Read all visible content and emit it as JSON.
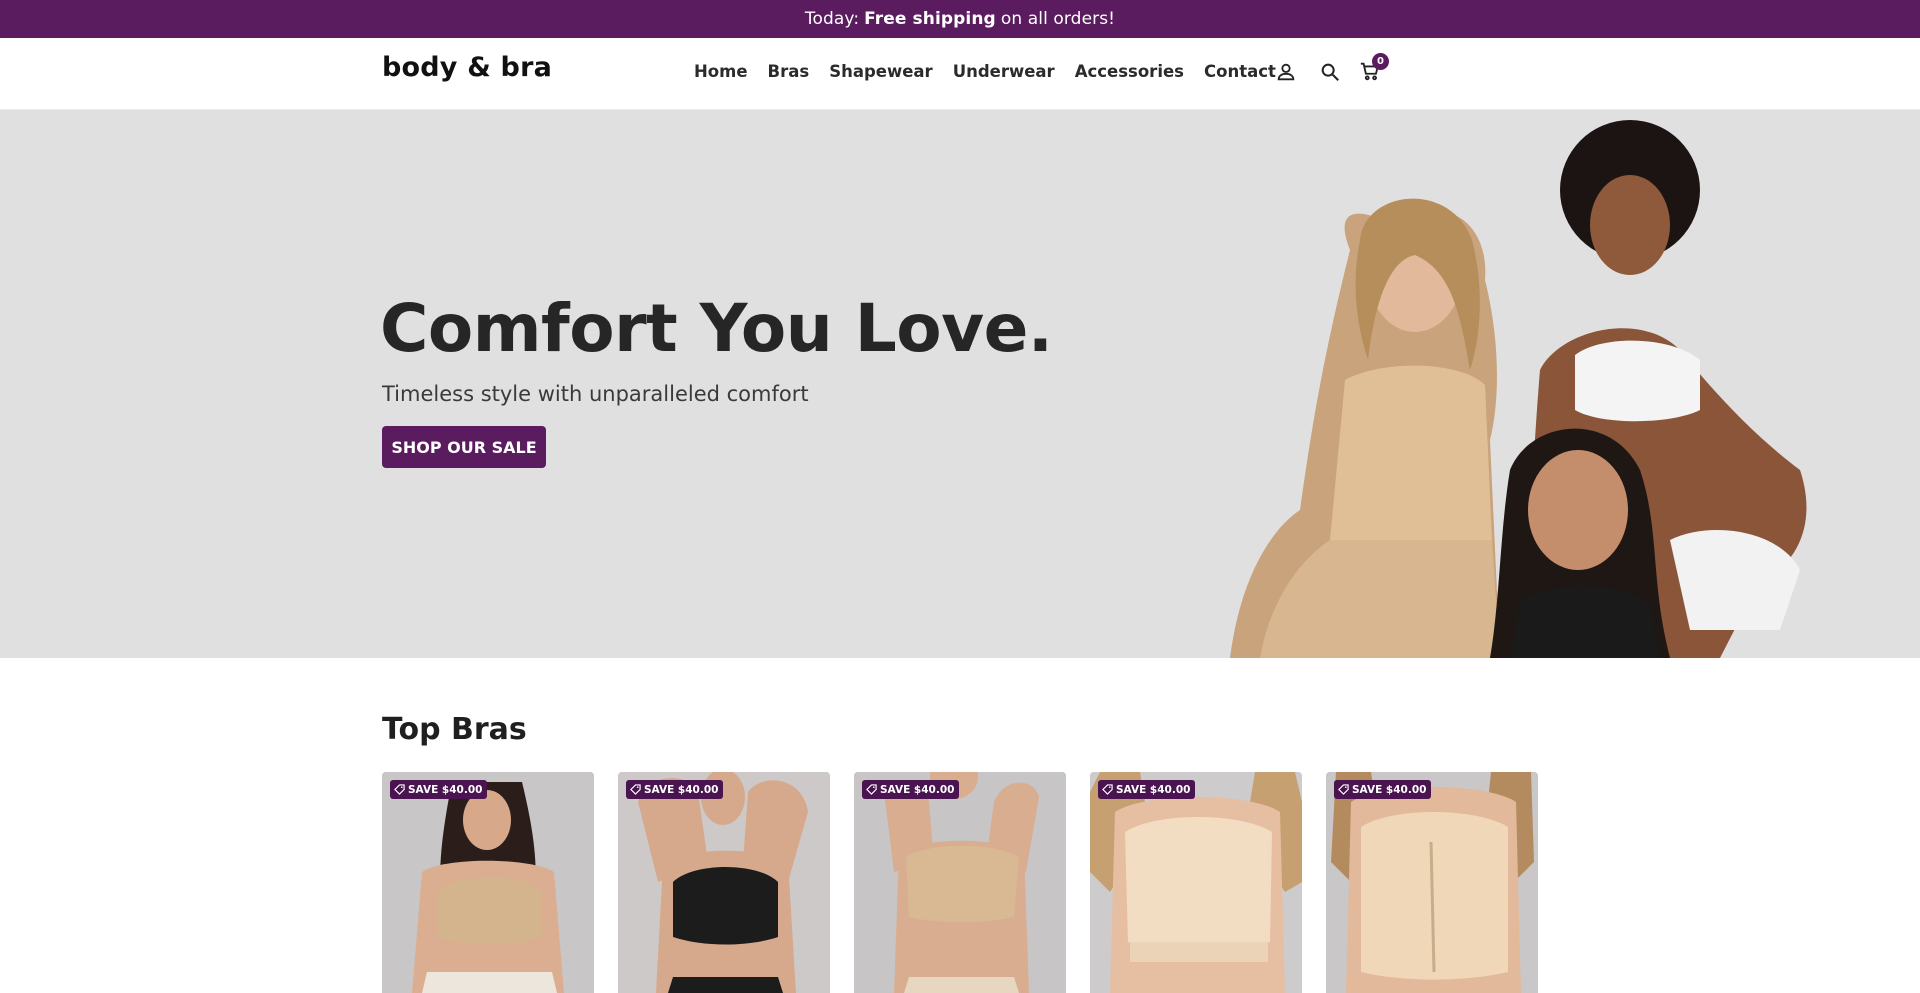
{
  "announcement": {
    "prefix": "Today:",
    "bold": "Free shipping",
    "suffix": "on all orders!"
  },
  "header": {
    "logo": "body & bra",
    "nav": [
      "Home",
      "Bras",
      "Shapewear",
      "Underwear",
      "Accessories",
      "Contact"
    ],
    "icons": [
      "account-icon",
      "search-icon",
      "cart-icon"
    ],
    "cart_count": "0"
  },
  "hero": {
    "title": "Comfort You Love.",
    "subtitle": "Timeless style with unparalleled comfort",
    "cta": "SHOP OUR SALE"
  },
  "section": {
    "title": "Top Bras"
  },
  "products": [
    {
      "badge": "SAVE $40.00",
      "bra_color": "#d4b48c",
      "bg": "#c8c6c7"
    },
    {
      "badge": "SAVE $40.00",
      "bra_color": "#1c1c1c",
      "bg": "#cdc9c8"
    },
    {
      "badge": "SAVE $40.00",
      "bra_color": "#d9b994",
      "bg": "#c7c5c6"
    },
    {
      "badge": "SAVE $40.00",
      "bra_color": "#f2dcc2",
      "bg": "#cdcbcc"
    },
    {
      "badge": "SAVE $40.00",
      "bra_color": "#f0d7b8",
      "bg": "#c9c7c8"
    }
  ],
  "colors": {
    "brand": "#5a1c5e",
    "hero_bg": "#e0e0e0"
  }
}
